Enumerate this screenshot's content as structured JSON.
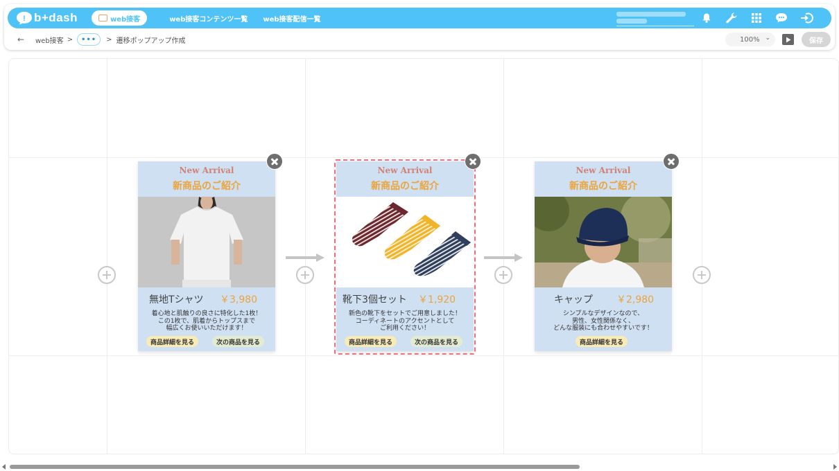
{
  "app": {
    "logo_text": "b+dash",
    "brand_color": "#4fc3f7"
  },
  "nav": {
    "active_pill": "web接客",
    "links": [
      "web接客コンテンツ一覧",
      "web接客配信一覧"
    ]
  },
  "top_icons": [
    "bell-icon",
    "wrench-icon",
    "grid-apps-icon",
    "chat-support-icon",
    "logout-icon"
  ],
  "breadcrumb": {
    "back_symbol": "←",
    "root": "web接客",
    "separator": ">",
    "ellipsis": "•••",
    "current": "遷移ポップアップ作成"
  },
  "toolbar": {
    "zoom": "100%",
    "zoom_caret": "⌄",
    "save_label": "保存"
  },
  "popups": [
    {
      "eyebrow": "New Arrival",
      "title": "新商品のご紹介",
      "image": "white-tshirt-model",
      "name": "無地Tシャツ",
      "price": "￥3,980",
      "desc": [
        "着心地と肌触りの良さに特化した1枚！",
        "この1枚で、肌着からトップスまで",
        "幅広くお使いいただけます！"
      ],
      "buttons": [
        "商品詳細を見る",
        "次の商品を見る"
      ]
    },
    {
      "eyebrow": "New Arrival",
      "title": "新商品のご紹介",
      "image": "striped-socks",
      "name": "靴下3個セット",
      "price": "￥1,920",
      "desc": [
        "新色の靴下をセットでご用意しました！",
        "コーディネートのアクセントとして",
        "ご利用ください！"
      ],
      "buttons": [
        "商品詳細を見る",
        "次の商品を見る"
      ],
      "selected": true
    },
    {
      "eyebrow": "New Arrival",
      "title": "新商品のご紹介",
      "image": "navy-cap-model",
      "name": "キャップ",
      "price": "￥2,980",
      "desc": [
        "シンプルなデザインなので、",
        "男性、女性関係なく、",
        "どんな服装にも合わせやすいです！"
      ],
      "buttons": [
        "商品詳細を見る"
      ]
    }
  ],
  "colors": {
    "popup_bg": "#cfe0f3",
    "eyebrow": "#cf8275",
    "accent_orange": "#eba43a",
    "selection": "#ef6f79"
  }
}
